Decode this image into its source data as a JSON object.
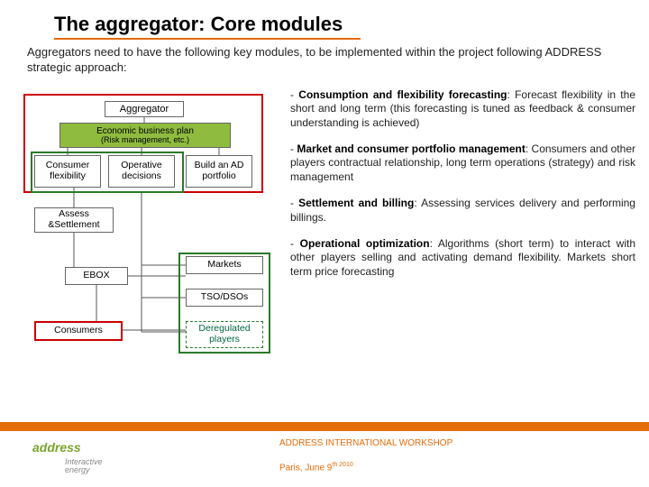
{
  "title": "The aggregator: Core modules",
  "intro": "Aggregators need to have the following key modules, to be implemented within the project following ADDRESS strategic approach:",
  "diagram": {
    "aggregator": "Aggregator",
    "economic": "Economic business plan",
    "economic_sub": "(Risk management, etc.)",
    "consumer_flex": "Consumer flexibility",
    "operative": "Operative decisions",
    "build_ad": "Build an AD portfolio",
    "assess": "Assess &Settlement",
    "ebox": "EBOX",
    "consumers": "Consumers",
    "markets": "Markets",
    "tso": "TSO/DSOs",
    "deregulated": "Deregulated players"
  },
  "bullets": [
    {
      "lead": "Consumption and flexibility forecasting",
      "body": ": Forecast flexibility in the short and long term (this forecasting is tuned as feedback & consumer understanding is achieved)"
    },
    {
      "lead": "Market and consumer portfolio management",
      "body": ": Consumers and other players contractual relationship, long term operations (strategy) and risk management"
    },
    {
      "lead": "Settlement and billing",
      "body": ": Assessing services delivery and performing billings."
    },
    {
      "lead": "Operational optimization",
      "body": ": Algorithms (short term) to interact with other players selling and activating demand flexibility. Markets short term price forecasting"
    }
  ],
  "footer": {
    "brand": "address",
    "tagline1": "Interactive",
    "tagline2": "energy",
    "workshop": "ADDRESS INTERNATIONAL WORKSHOP",
    "location": "Paris, June 9",
    "locsuffix": "th 2010"
  }
}
